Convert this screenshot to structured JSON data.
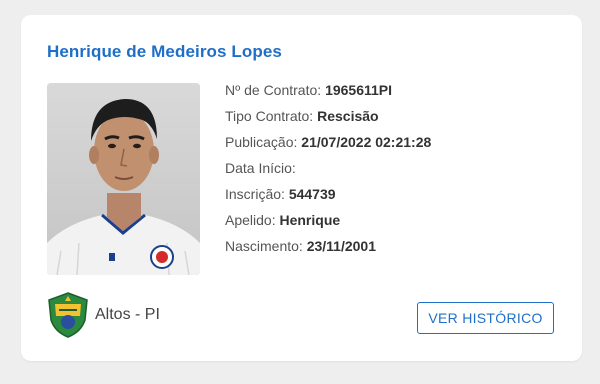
{
  "player": {
    "name": "Henrique de Medeiros Lopes"
  },
  "fields": [
    {
      "label": "Nº de Contrato:",
      "value": "1965611PI"
    },
    {
      "label": "Tipo Contrato:",
      "value": "Rescisão"
    },
    {
      "label": "Publicação:",
      "value": "21/07/2022 02:21:28"
    },
    {
      "label": "Data Início:",
      "value": ""
    },
    {
      "label": "Inscrição:",
      "value": "544739"
    },
    {
      "label": "Apelido:",
      "value": "Henrique"
    },
    {
      "label": "Nascimento:",
      "value": "23/11/2001"
    }
  ],
  "club": {
    "name": "Altos - PI",
    "logo_icon": "club-crest-icon"
  },
  "actions": {
    "history_label": "VER HISTÓRICO"
  },
  "colors": {
    "accent": "#1f6fc8",
    "background": "#eeeeee",
    "card": "#ffffff"
  }
}
